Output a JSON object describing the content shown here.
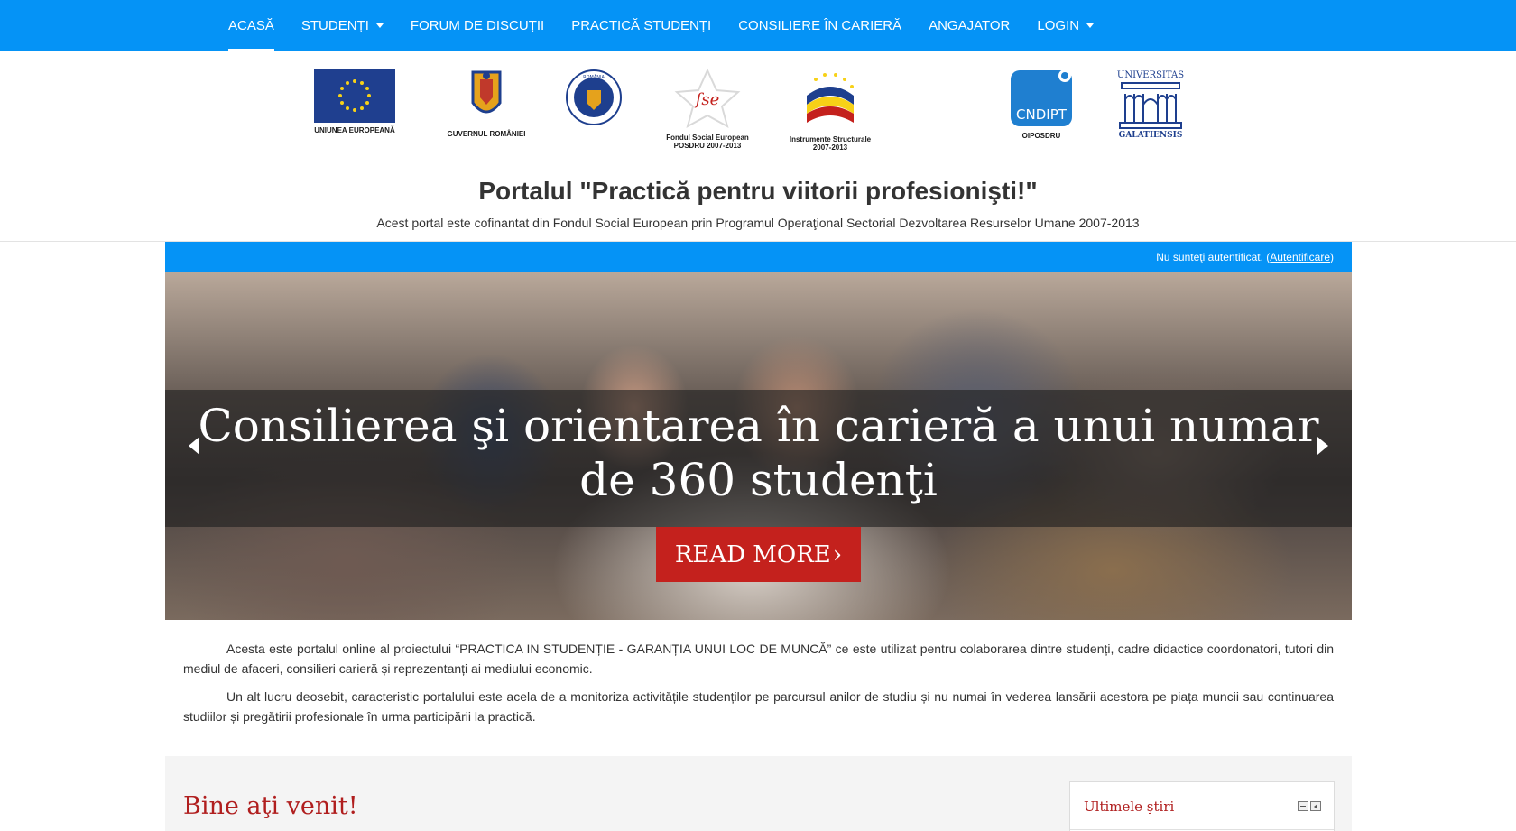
{
  "nav": {
    "items": [
      {
        "label": "ACASĂ",
        "active": true,
        "dropdown": false
      },
      {
        "label": "STUDENȚI",
        "active": false,
        "dropdown": true
      },
      {
        "label": "FORUM DE DISCUȚII",
        "active": false,
        "dropdown": false
      },
      {
        "label": "PRACTICĂ STUDENȚI",
        "active": false,
        "dropdown": false
      },
      {
        "label": "CONSILIERE ÎN CARIERĂ",
        "active": false,
        "dropdown": false
      },
      {
        "label": "ANGAJATOR",
        "active": false,
        "dropdown": false
      },
      {
        "label": "LOGIN",
        "active": false,
        "dropdown": true
      }
    ]
  },
  "logos": {
    "eu": "UNIUNEA EUROPEANĂ",
    "gov": "GUVERNUL ROMÂNIEI",
    "ministry_seal": "ROMÂNIA",
    "fse": "Fondul Social European\nPOSDRU 2007-2013",
    "fse_mark": "fse",
    "is": "Instrumente Structurale\n2007-2013",
    "cndipt": "OIPOSDRU",
    "cndipt_mark": "CNDIPT",
    "ugal": "GALATIENSIS",
    "ugal_mark": "UNIVERSITAS"
  },
  "header": {
    "title": "Portalul \"Practică pentru viitorii profesionişti!\"",
    "subtitle": "Acest portal este cofinantat din Fondul Social European prin Programul Operaţional Sectorial Dezvoltarea Resurselor Umane 2007-2013"
  },
  "auth": {
    "status": "Nu sunteţi autentificat. (",
    "link": "Autentificare",
    "close": ")"
  },
  "slider": {
    "title": "Consilierea şi orientarea în carieră a unui numar de 360 studenţi",
    "button": "READ MORE",
    "button_icon": "chevron-right-icon",
    "prev_icon": "triangle-left-icon",
    "next_icon": "triangle-right-icon"
  },
  "intro": {
    "paragraphs": [
      "Acesta este portalul online al proiectului “PRACTICA IN STUDENȚIE - GARANȚIA UNUI LOC DE MUNCĂ”  ce este utilizat pentru colaborarea dintre studenți, cadre didactice coordonatori, tutori din mediul de afaceri, consilieri carieră și reprezentanți ai mediului economic.",
      "Un alt lucru deosebit, caracteristic portalului este acela de a monitoriza activitățile studenților pe parcursul anilor de studiu și nu numai în vederea lansării acestora pe piața muncii sau continuarea studiilor și pregătirii profesionale în urma participării la practică."
    ]
  },
  "main": {
    "welcome": "Bine aţi venit!"
  },
  "news": {
    "title": "Ultimele ştiri"
  },
  "colors": {
    "primary": "#0593f6",
    "accent_red": "#c4211d",
    "heading_red": "#b01e1e"
  }
}
